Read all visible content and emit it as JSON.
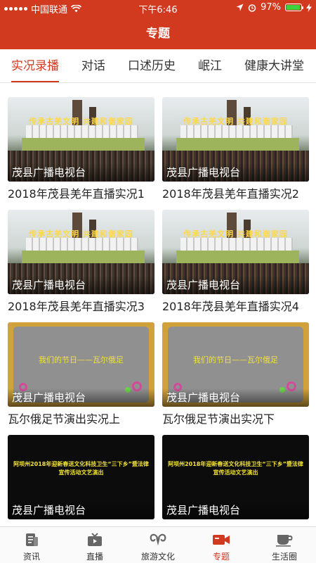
{
  "status_bar": {
    "carrier": "中国联通",
    "time": "下午6:46",
    "battery": "97%"
  },
  "header": {
    "title": "专题"
  },
  "tabs": [
    {
      "label": "实况录播",
      "active": true
    },
    {
      "label": "对话",
      "active": false
    },
    {
      "label": "口述历史",
      "active": false
    },
    {
      "label": "岷江",
      "active": false
    },
    {
      "label": "健康大讲堂",
      "active": false
    }
  ],
  "cards": [
    {
      "thumb_type": "scene",
      "overlay": "茂县广播电视台",
      "title": "2018年茂县羌年直播实况1",
      "banner": "传承古羌文明 共建和谐家园"
    },
    {
      "thumb_type": "scene",
      "overlay": "茂县广播电视台",
      "title": "2018年茂县羌年直播实况2",
      "banner": "传承古羌文明 共建和谐家园"
    },
    {
      "thumb_type": "scene",
      "overlay": "茂县广播电视台",
      "title": "2018年茂县羌年直播实况3",
      "banner": "传承古羌文明 共建和谐家园"
    },
    {
      "thumb_type": "scene",
      "overlay": "茂县广播电视台",
      "title": "2018年茂县羌年直播实况4",
      "banner": "传承古羌文明 共建和谐家园"
    },
    {
      "thumb_type": "yframe",
      "overlay": "茂县广播电视台",
      "title": "瓦尔俄足节演出实况上",
      "banner": "我们的节日——瓦尔俄足"
    },
    {
      "thumb_type": "yframe",
      "overlay": "茂县广播电视台",
      "title": "瓦尔俄足节演出实况下",
      "banner": "我们的节日——瓦尔俄足"
    },
    {
      "thumb_type": "bslide",
      "overlay": "茂县广播电视台",
      "title": "",
      "banner": "阿坝州2018年迎新春送文化科技卫生“三下乡”暨法律宣传活动文艺演出"
    },
    {
      "thumb_type": "bslide",
      "overlay": "茂县广播电视台",
      "title": "",
      "banner": "阿坝州2018年迎新春送文化科技卫生“三下乡”暨法律宣传活动文艺演出"
    }
  ],
  "bottom_nav": [
    {
      "label": "资讯",
      "icon": "news-icon",
      "active": false
    },
    {
      "label": "直播",
      "icon": "tv-icon",
      "active": false
    },
    {
      "label": "旅游文化",
      "icon": "ram-horns-icon",
      "active": false
    },
    {
      "label": "专题",
      "icon": "video-camera-icon",
      "active": true
    },
    {
      "label": "生活圈",
      "icon": "coffee-cup-icon",
      "active": false
    }
  ],
  "colors": {
    "accent": "#d23a20"
  }
}
